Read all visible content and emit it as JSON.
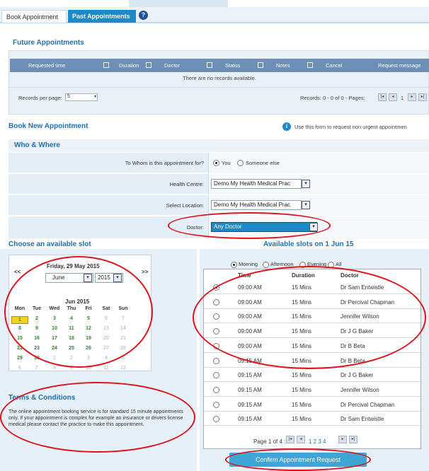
{
  "tabs": {
    "book": "Book Appointment",
    "past": "Past Appointments",
    "help": "?"
  },
  "future": {
    "title": "Future Appointments",
    "columns": [
      "Requested time",
      "Duration",
      "Doctor",
      "Status",
      "Notes",
      "Cancel",
      "Request message"
    ],
    "empty": "There are no records available.",
    "records_per_page_label": "Records per page:",
    "records_per_page_value": "5",
    "records_info": "Records: 0 - 0 of 0 - Pages:",
    "pager_page": "1"
  },
  "book_new": {
    "title": "Book New Appointment",
    "info_text": "Use this form to request non urgent appointmen"
  },
  "who_where": {
    "title": "Who & Where",
    "to_whom_label": "To Whom is this appointment for?",
    "to_whom_options": [
      "You",
      "Someone else"
    ],
    "health_centre_label": "Health Centre:",
    "health_centre_value": "Demo My Health Medical Prac",
    "location_label": "Select Location:",
    "location_value": "Demo My Health Medical Prac",
    "doctor_label": "Doctor:",
    "doctor_value": "Any Doctor"
  },
  "slot_heading": "Choose an available slot",
  "available_heading": "Available slots on 1 Jun 15",
  "calendar": {
    "prev": "<<",
    "next": ">>",
    "date_title": "Friday, 29 May 2015",
    "month": "June",
    "year": "2015",
    "month_title": "Jun 2015",
    "weekdays": [
      "Mon",
      "Tue",
      "Wed",
      "Thu",
      "Fri",
      "Sat",
      "Sun"
    ],
    "rows": [
      [
        "1",
        "2",
        "3",
        "4",
        "5",
        "6",
        "7"
      ],
      [
        "8",
        "9",
        "10",
        "11",
        "12",
        "13",
        "14"
      ],
      [
        "15",
        "16",
        "17",
        "18",
        "19",
        "20",
        "21"
      ],
      [
        "22",
        "23",
        "24",
        "25",
        "26",
        "27",
        "28"
      ],
      [
        "29",
        "30",
        "1",
        "2",
        "3",
        "4",
        "5"
      ],
      [
        "6",
        "7",
        "8",
        "9",
        "10",
        "11",
        "12"
      ]
    ]
  },
  "terms": {
    "title": "Terms & Conditions",
    "text": "The online appointment booking service is for standard 15 minute appointments only. If your appointment is complex for example an insurance or drivers license medical please contact the practice to make this appointment."
  },
  "slots": {
    "time_filters": [
      "Morning",
      "Afternoon",
      "Evening",
      "All"
    ],
    "headers": [
      "Time",
      "Duration",
      "Doctor"
    ],
    "rows": [
      {
        "time": "09:00 AM",
        "duration": "15 Mins",
        "doctor": "Dr Sam Entwistle"
      },
      {
        "time": "09:00 AM",
        "duration": "15 Mins",
        "doctor": "Dr Percival Chapman"
      },
      {
        "time": "09:00 AM",
        "duration": "15 Mins",
        "doctor": "Jennifer Wilson"
      },
      {
        "time": "09:00 AM",
        "duration": "15 Mins",
        "doctor": "Dr J G Baker"
      },
      {
        "time": "09:00 AM",
        "duration": "15 Mins",
        "doctor": "Dr B Beta"
      },
      {
        "time": "09:15 AM",
        "duration": "15 Mins",
        "doctor": "Dr B Beta"
      },
      {
        "time": "09:15 AM",
        "duration": "15 Mins",
        "doctor": "Dr J G Baker"
      },
      {
        "time": "09:15 AM",
        "duration": "15 Mins",
        "doctor": "Jennifer Wilson"
      },
      {
        "time": "09:15 AM",
        "duration": "15 Mins",
        "doctor": "Dr Percival Chapman"
      },
      {
        "time": "09:15 AM",
        "duration": "15 Mins",
        "doctor": "Dr Sam Entwistle"
      }
    ],
    "page_info": "Page 1 of 4 :",
    "pages": "1 2 3 4"
  },
  "confirm_label": "Confirm Appointment Request",
  "colors": {
    "accent": "#1e6fb5",
    "highlight": "#e0121a",
    "selected_day": "#f2d21c"
  }
}
